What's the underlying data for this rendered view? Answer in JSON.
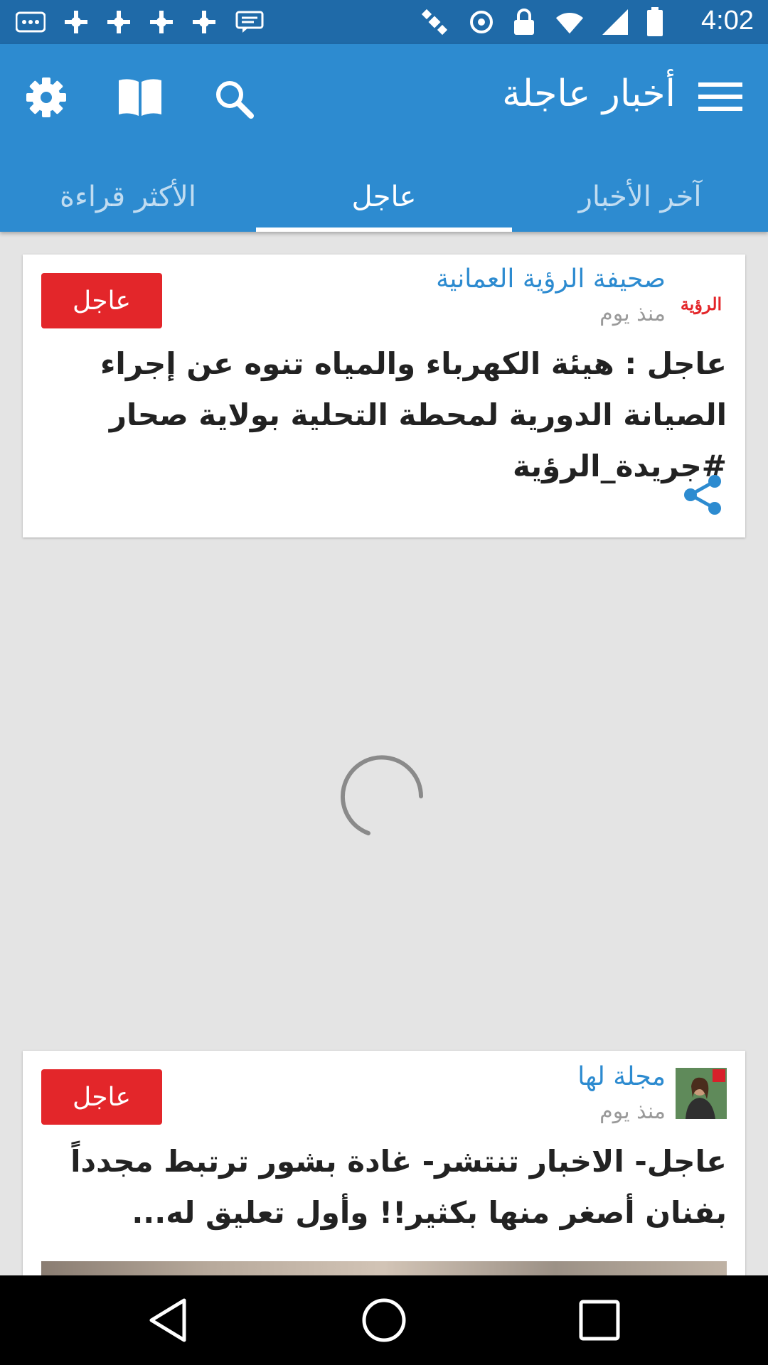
{
  "status_bar": {
    "time": "4:02",
    "icons": [
      "more-icon",
      "fan-icon",
      "fan-icon",
      "fan-icon",
      "fan-icon",
      "message-icon",
      "satellite-icon",
      "sync-icon",
      "lock-icon",
      "wifi-icon",
      "cell-signal-icon",
      "battery-icon"
    ]
  },
  "toolbar": {
    "title": "أخبار عاجلة",
    "icons": [
      "menu-icon",
      "search-icon",
      "book-icon",
      "settings-icon"
    ]
  },
  "tabs": [
    {
      "label": "آخر الأخبار",
      "active": false
    },
    {
      "label": "عاجل",
      "active": true
    },
    {
      "label": "الأكثر قراءة",
      "active": false
    }
  ],
  "articles": [
    {
      "source": "صحيفة الرؤية العمانية",
      "time": "منذ يوم",
      "badge": "عاجل",
      "logo_text": "الرؤية",
      "headline": "عاجل : هيئة الكهرباء والمياه تنوه عن إجراء الصيانة الدورية لمحطة التحلية بولاية صحار #جريدة_الرؤية"
    },
    {
      "source": "مجلة لها",
      "time": "منذ يوم",
      "badge": "عاجل",
      "headline": "عاجل- الاخبار تنتشر- غادة بشور ترتبط مجدداً بفنان أصغر منها بكثير!! وأول تعليق له..."
    }
  ],
  "colors": {
    "primary": "#2d8bd0",
    "status_bar": "#1f6aa8",
    "badge": "#e3262a",
    "background": "#e4e4e4"
  }
}
